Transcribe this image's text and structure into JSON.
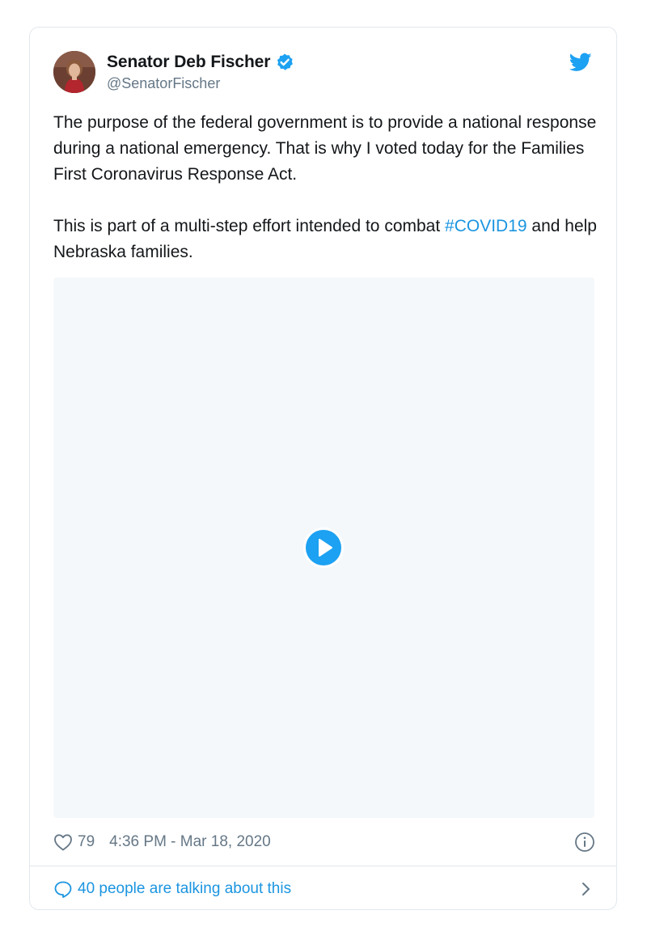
{
  "author": {
    "display_name": "Senator Deb Fischer",
    "handle": "@SenatorFischer",
    "verified": true
  },
  "tweet": {
    "paragraph_1": "The purpose of the federal government is to provide a national response during a national emergency. That is why I voted today for the Families First Coronavirus Response Act.",
    "paragraph_2_text": "This is part of a multi-step effort intended to combat ",
    "paragraph_2_hashtag": "#COVID19",
    "paragraph_2_end": " and help Nebraska families."
  },
  "media": {
    "type": "video",
    "icon": "play-icon"
  },
  "footer": {
    "likes": "79",
    "timestamp": "4:36 PM - Mar 18, 2020",
    "talking": "40 people are talking about this"
  },
  "icons": {
    "brand": "twitter-bird-icon",
    "verified": "verified-badge-icon",
    "like": "heart-icon",
    "info": "info-icon",
    "reply": "speech-bubble-icon",
    "more": "chevron-right-icon"
  },
  "colors": {
    "brand_blue": "#1da1f2",
    "link_blue": "#1b95e0",
    "text": "#14171a",
    "muted": "#657786",
    "border": "#e1e8ed",
    "media_bg": "#f5f8fa"
  }
}
